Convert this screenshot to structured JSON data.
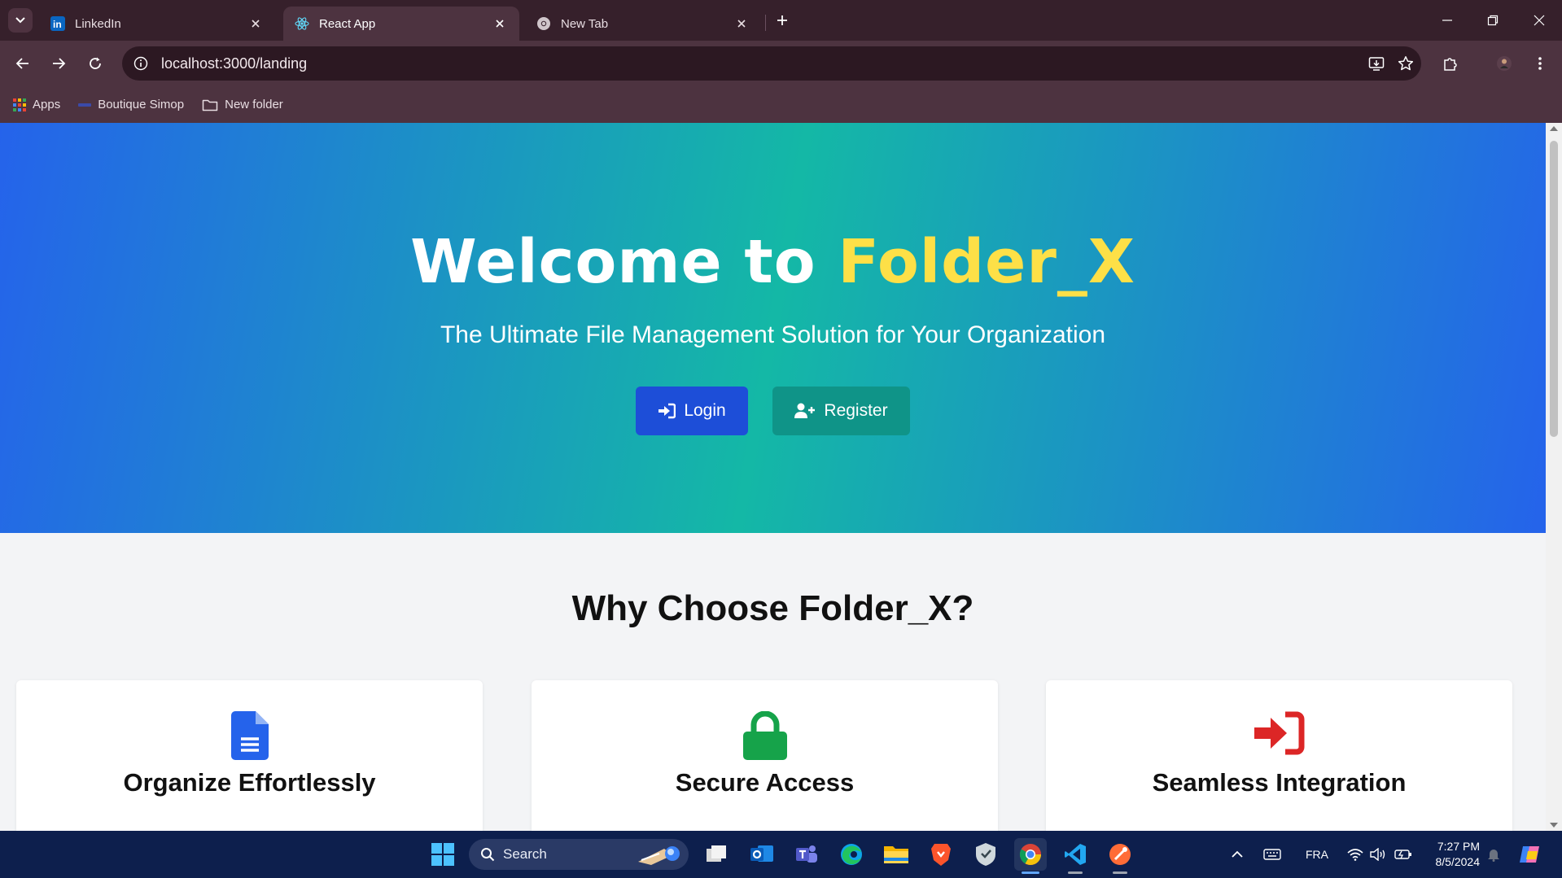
{
  "browser": {
    "tabs": [
      {
        "title": "LinkedIn",
        "icon": "linkedin-icon",
        "active": false
      },
      {
        "title": "React App",
        "icon": "react-icon",
        "active": true
      },
      {
        "title": "New Tab",
        "icon": "chrome-icon",
        "active": false
      }
    ],
    "url": "localhost:3000/landing",
    "bookmarks": [
      {
        "label": "Apps",
        "icon": "apps-grid-icon"
      },
      {
        "label": "Boutique Simop",
        "icon": "site-icon"
      },
      {
        "label": "New folder",
        "icon": "folder-icon"
      }
    ]
  },
  "page": {
    "hero": {
      "title_prefix": "Welcome to ",
      "title_brand": "Folder_X",
      "subtitle": "The Ultimate File Management Solution for Your Organization",
      "login_label": "Login",
      "register_label": "Register"
    },
    "why": {
      "title": "Why Choose Folder_X?",
      "features": [
        {
          "title": "Organize Effortlessly",
          "icon": "document-icon",
          "color": "#2563eb"
        },
        {
          "title": "Secure Access",
          "icon": "lock-icon",
          "color": "#16a34a"
        },
        {
          "title": "Seamless Integration",
          "icon": "sign-in-icon",
          "color": "#dc2626"
        }
      ]
    },
    "colors": {
      "hero_gradient": [
        "#2563eb",
        "#14b8a6",
        "#2563eb"
      ],
      "brand_yellow": "#fde047",
      "login_button": "#1d4ed8",
      "register_button": "#0f9488"
    }
  },
  "taskbar": {
    "search_label": "Search",
    "language": "FRA",
    "time": "7:27 PM",
    "date": "8/5/2024"
  }
}
